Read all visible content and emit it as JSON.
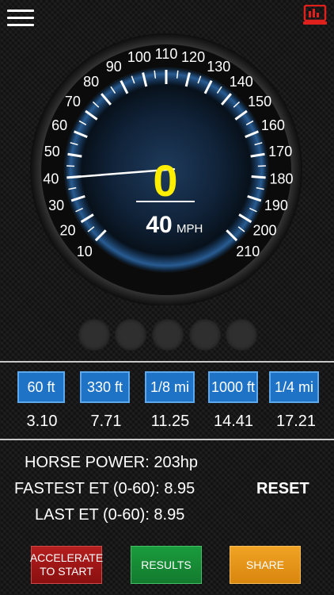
{
  "header": {
    "menu_icon": "hamburger-menu-icon",
    "monitor_icon": "monitor-icon"
  },
  "gauge": {
    "current_speed": "0",
    "target_speed": "40",
    "unit": "MPH",
    "min": 10,
    "max": 210,
    "step": 10,
    "needle_value": 40,
    "labels": [
      "10",
      "20",
      "30",
      "40",
      "50",
      "60",
      "70",
      "80",
      "90",
      "100",
      "110",
      "120",
      "130",
      "140",
      "150",
      "160",
      "170",
      "180",
      "190",
      "200",
      "210"
    ]
  },
  "distances": [
    {
      "label": "60 ft",
      "value": "3.10"
    },
    {
      "label": "330 ft",
      "value": "7.71"
    },
    {
      "label": "1/8 mi",
      "value": "11.25"
    },
    {
      "label": "1000 ft",
      "value": "14.41"
    },
    {
      "label": "1/4 mi",
      "value": "17.21"
    }
  ],
  "stats": {
    "horse_power": "HORSE POWER: 203hp",
    "fastest_et": "FASTEST ET (0-60): 8.95",
    "last_et": "LAST ET (0-60): 8.95",
    "reset_label": "RESET"
  },
  "actions": {
    "accelerate_line1": "ACCELERATE",
    "accelerate_line2": "TO START",
    "results": "RESULTS",
    "share": "SHARE"
  },
  "colors": {
    "speed": "#ffee00",
    "accent_blue": "#1f73c7",
    "red": "#b51e1e",
    "green": "#1a9c3d",
    "orange": "#f0a324"
  }
}
